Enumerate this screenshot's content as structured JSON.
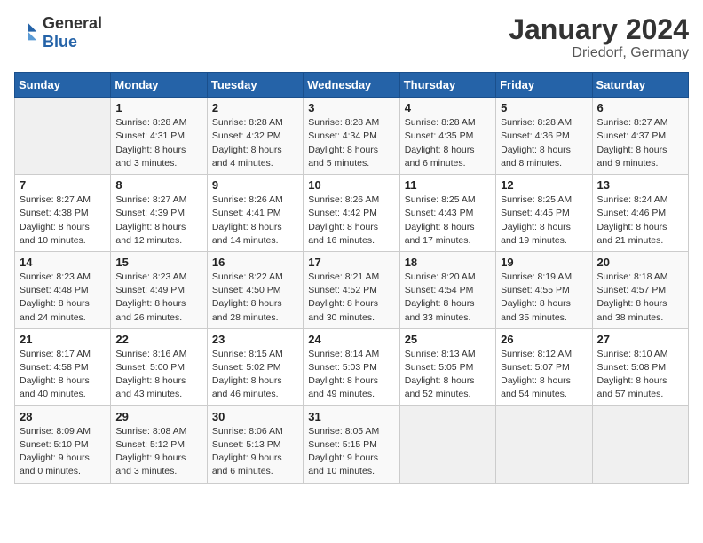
{
  "header": {
    "logo_general": "General",
    "logo_blue": "Blue",
    "month_year": "January 2024",
    "location": "Driedorf, Germany"
  },
  "days_of_week": [
    "Sunday",
    "Monday",
    "Tuesday",
    "Wednesday",
    "Thursday",
    "Friday",
    "Saturday"
  ],
  "weeks": [
    [
      {
        "day": "",
        "info": ""
      },
      {
        "day": "1",
        "info": "Sunrise: 8:28 AM\nSunset: 4:31 PM\nDaylight: 8 hours\nand 3 minutes."
      },
      {
        "day": "2",
        "info": "Sunrise: 8:28 AM\nSunset: 4:32 PM\nDaylight: 8 hours\nand 4 minutes."
      },
      {
        "day": "3",
        "info": "Sunrise: 8:28 AM\nSunset: 4:34 PM\nDaylight: 8 hours\nand 5 minutes."
      },
      {
        "day": "4",
        "info": "Sunrise: 8:28 AM\nSunset: 4:35 PM\nDaylight: 8 hours\nand 6 minutes."
      },
      {
        "day": "5",
        "info": "Sunrise: 8:28 AM\nSunset: 4:36 PM\nDaylight: 8 hours\nand 8 minutes."
      },
      {
        "day": "6",
        "info": "Sunrise: 8:27 AM\nSunset: 4:37 PM\nDaylight: 8 hours\nand 9 minutes."
      }
    ],
    [
      {
        "day": "7",
        "info": "Sunrise: 8:27 AM\nSunset: 4:38 PM\nDaylight: 8 hours\nand 10 minutes."
      },
      {
        "day": "8",
        "info": "Sunrise: 8:27 AM\nSunset: 4:39 PM\nDaylight: 8 hours\nand 12 minutes."
      },
      {
        "day": "9",
        "info": "Sunrise: 8:26 AM\nSunset: 4:41 PM\nDaylight: 8 hours\nand 14 minutes."
      },
      {
        "day": "10",
        "info": "Sunrise: 8:26 AM\nSunset: 4:42 PM\nDaylight: 8 hours\nand 16 minutes."
      },
      {
        "day": "11",
        "info": "Sunrise: 8:25 AM\nSunset: 4:43 PM\nDaylight: 8 hours\nand 17 minutes."
      },
      {
        "day": "12",
        "info": "Sunrise: 8:25 AM\nSunset: 4:45 PM\nDaylight: 8 hours\nand 19 minutes."
      },
      {
        "day": "13",
        "info": "Sunrise: 8:24 AM\nSunset: 4:46 PM\nDaylight: 8 hours\nand 21 minutes."
      }
    ],
    [
      {
        "day": "14",
        "info": "Sunrise: 8:23 AM\nSunset: 4:48 PM\nDaylight: 8 hours\nand 24 minutes."
      },
      {
        "day": "15",
        "info": "Sunrise: 8:23 AM\nSunset: 4:49 PM\nDaylight: 8 hours\nand 26 minutes."
      },
      {
        "day": "16",
        "info": "Sunrise: 8:22 AM\nSunset: 4:50 PM\nDaylight: 8 hours\nand 28 minutes."
      },
      {
        "day": "17",
        "info": "Sunrise: 8:21 AM\nSunset: 4:52 PM\nDaylight: 8 hours\nand 30 minutes."
      },
      {
        "day": "18",
        "info": "Sunrise: 8:20 AM\nSunset: 4:54 PM\nDaylight: 8 hours\nand 33 minutes."
      },
      {
        "day": "19",
        "info": "Sunrise: 8:19 AM\nSunset: 4:55 PM\nDaylight: 8 hours\nand 35 minutes."
      },
      {
        "day": "20",
        "info": "Sunrise: 8:18 AM\nSunset: 4:57 PM\nDaylight: 8 hours\nand 38 minutes."
      }
    ],
    [
      {
        "day": "21",
        "info": "Sunrise: 8:17 AM\nSunset: 4:58 PM\nDaylight: 8 hours\nand 40 minutes."
      },
      {
        "day": "22",
        "info": "Sunrise: 8:16 AM\nSunset: 5:00 PM\nDaylight: 8 hours\nand 43 minutes."
      },
      {
        "day": "23",
        "info": "Sunrise: 8:15 AM\nSunset: 5:02 PM\nDaylight: 8 hours\nand 46 minutes."
      },
      {
        "day": "24",
        "info": "Sunrise: 8:14 AM\nSunset: 5:03 PM\nDaylight: 8 hours\nand 49 minutes."
      },
      {
        "day": "25",
        "info": "Sunrise: 8:13 AM\nSunset: 5:05 PM\nDaylight: 8 hours\nand 52 minutes."
      },
      {
        "day": "26",
        "info": "Sunrise: 8:12 AM\nSunset: 5:07 PM\nDaylight: 8 hours\nand 54 minutes."
      },
      {
        "day": "27",
        "info": "Sunrise: 8:10 AM\nSunset: 5:08 PM\nDaylight: 8 hours\nand 57 minutes."
      }
    ],
    [
      {
        "day": "28",
        "info": "Sunrise: 8:09 AM\nSunset: 5:10 PM\nDaylight: 9 hours\nand 0 minutes."
      },
      {
        "day": "29",
        "info": "Sunrise: 8:08 AM\nSunset: 5:12 PM\nDaylight: 9 hours\nand 3 minutes."
      },
      {
        "day": "30",
        "info": "Sunrise: 8:06 AM\nSunset: 5:13 PM\nDaylight: 9 hours\nand 6 minutes."
      },
      {
        "day": "31",
        "info": "Sunrise: 8:05 AM\nSunset: 5:15 PM\nDaylight: 9 hours\nand 10 minutes."
      },
      {
        "day": "",
        "info": ""
      },
      {
        "day": "",
        "info": ""
      },
      {
        "day": "",
        "info": ""
      }
    ]
  ]
}
